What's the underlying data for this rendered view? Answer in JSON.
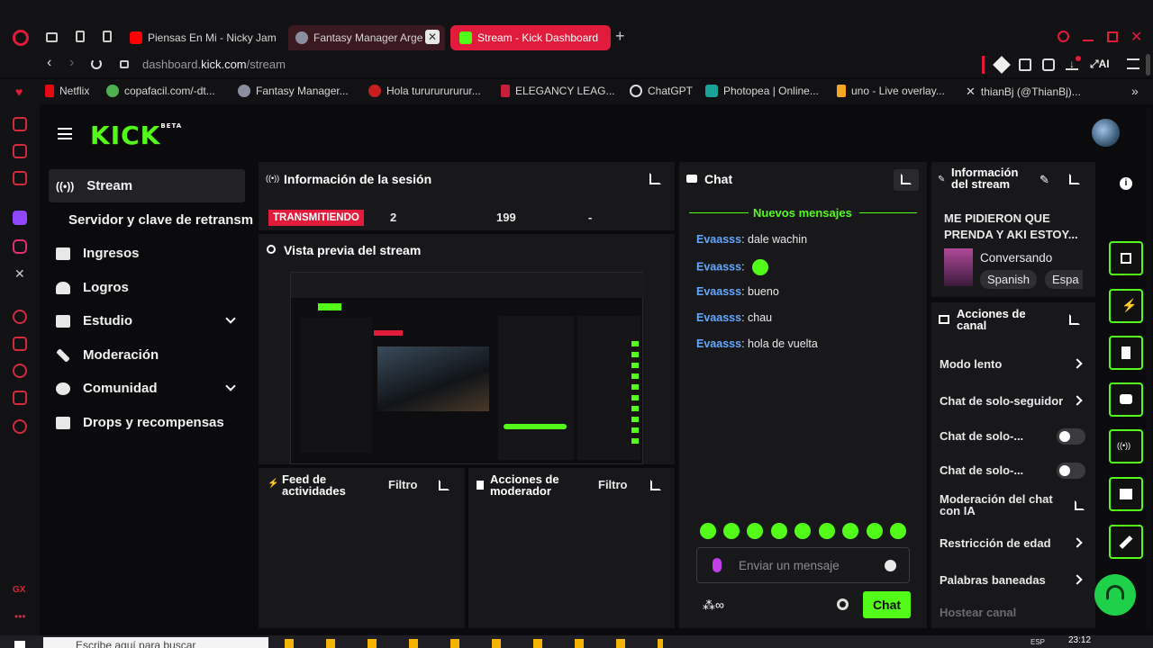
{
  "browser": {
    "tabs": [
      {
        "label": "Piensas En Mi - Nicky Jam"
      },
      {
        "label": "Fantasy Manager Arge"
      },
      {
        "label": "Stream - Kick Dashboard"
      }
    ],
    "url_host": "dashboard.",
    "url_domain": "kick.com",
    "url_path": "/stream",
    "ai_label": "AI",
    "bookmarks": [
      {
        "label": "Netflix"
      },
      {
        "label": "copafacil.com/-dt..."
      },
      {
        "label": "Fantasy Manager..."
      },
      {
        "label": "Hola turururururur..."
      },
      {
        "label": "ELEGANCY LEAG..."
      },
      {
        "label": "ChatGPT"
      },
      {
        "label": "Photopea | Online..."
      },
      {
        "label": "uno - Live overlay..."
      },
      {
        "label": "thianBj (@ThianBj)..."
      }
    ],
    "gx_label": "GX"
  },
  "logo": {
    "text": "KICK",
    "beta": "BETA"
  },
  "sidebar": {
    "items": [
      {
        "label": "Stream"
      },
      {
        "label": "Servidor y clave de retransm"
      },
      {
        "label": "Ingresos"
      },
      {
        "label": "Logros"
      },
      {
        "label": "Estudio"
      },
      {
        "label": "Moderación"
      },
      {
        "label": "Comunidad"
      },
      {
        "label": "Drops y recompensas"
      }
    ]
  },
  "session": {
    "title": "Información de la sesión",
    "status": "TRANSMITIENDO",
    "stat1": "2",
    "stat2": "199",
    "stat3": "-"
  },
  "preview": {
    "title": "Vista previa del stream"
  },
  "feed": {
    "title": "Feed de actividades",
    "filter": "Filtro"
  },
  "modactions": {
    "title": "Acciones de moderador",
    "filter": "Filtro"
  },
  "chat": {
    "title": "Chat",
    "new_messages": "Nuevos mensajes",
    "messages": [
      {
        "user": "Evaasss",
        "text": ": dale wachin"
      },
      {
        "user": "Evaasss",
        "text": ":"
      },
      {
        "user": "Evaasss",
        "text": ": bueno"
      },
      {
        "user": "Evaasss",
        "text": ": chau"
      },
      {
        "user": "Evaasss",
        "text": ": hola de vuelta"
      }
    ],
    "input_placeholder": "Enviar un mensaje",
    "send_label": "Chat"
  },
  "streaminfo": {
    "title": "Información del stream",
    "stream_title": "ME PIDIERON QUE PRENDA Y AKI ESTOY...",
    "category": "Conversando",
    "tags": [
      "Spanish",
      "Espa"
    ]
  },
  "channel": {
    "title": "Acciones de canal",
    "items": [
      {
        "label": "Modo lento"
      },
      {
        "label": "Chat de solo-seguidor"
      },
      {
        "label": "Chat de solo-..."
      },
      {
        "label": "Chat de solo-..."
      },
      {
        "label": "Moderación del chat con IA"
      },
      {
        "label": "Restricción de edad"
      },
      {
        "label": "Palabras baneadas"
      },
      {
        "label": "Hostear canal"
      }
    ]
  },
  "taskbar": {
    "search_placeholder": "Escribe aquí para buscar",
    "time": "23:12",
    "lang": "ESP"
  },
  "colors": {
    "kick_green": "#53fc18",
    "live_red": "#e01b3c",
    "chat_user": "#63a8ff"
  }
}
